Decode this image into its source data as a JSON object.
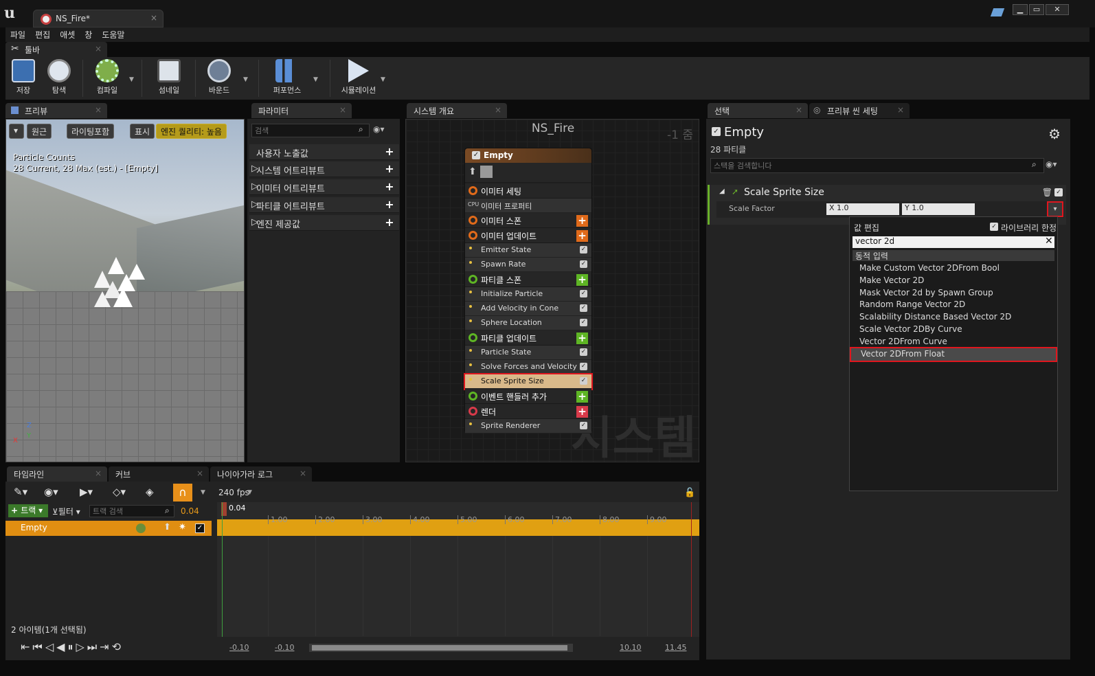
{
  "window": {
    "tab_title": "NS_Fire*",
    "close": "×",
    "min": "▁",
    "max": "▭",
    "close_btn": "✕"
  },
  "menu": [
    "파일",
    "편집",
    "애셋",
    "창",
    "도움말"
  ],
  "toolbar": {
    "tab_label": "툴바",
    "buttons": [
      {
        "label": "저장"
      },
      {
        "label": "탐색"
      },
      {
        "label": "컴파일"
      },
      {
        "label": "섬네일"
      },
      {
        "label": "바운드"
      },
      {
        "label": "퍼포먼스"
      },
      {
        "label": "시뮬레이션"
      }
    ]
  },
  "preview": {
    "tab": "프리뷰",
    "btn_perspective": "원근",
    "btn_lighting": "라이팅포함",
    "btn_show": "표시",
    "btn_quality": "엔진 퀄리티: 높음",
    "counts_title": "Particle Counts",
    "counts_text": "28 Current, 28 Max (est.) - [Empty]",
    "axis_z": "Z",
    "axis_x": "X",
    "axis_y": "Y"
  },
  "params": {
    "tab": "파라미터",
    "search_placeholder": "검색",
    "rows": [
      "사용자 노출값",
      "시스템 어트리뷰트",
      "이미터 어트리뷰트",
      "파티클 어트리뷰트",
      "엔진 제공값"
    ]
  },
  "graph": {
    "tab": "시스템 개요",
    "title": "NS_Fire",
    "zoom": "-1 줌",
    "watermark": "시스템",
    "emitter_name": "Empty",
    "sections": [
      {
        "type": "head",
        "label": "이미터 세팅",
        "color": "#e06a1a"
      },
      {
        "type": "sub",
        "label": "이미터 프로퍼티",
        "cpu": true
      },
      {
        "type": "head",
        "label": "이미터 스폰",
        "color": "#e06a1a",
        "plus": "#e06a1a"
      },
      {
        "type": "head",
        "label": "이미터 업데이트",
        "color": "#e06a1a",
        "plus": "#e06a1a"
      },
      {
        "type": "row",
        "label": "Emitter State"
      },
      {
        "type": "row",
        "label": "Spawn Rate"
      },
      {
        "type": "head",
        "label": "파티클 스폰",
        "color": "#5eb524",
        "plus": "#5eb524"
      },
      {
        "type": "row",
        "label": "Initialize Particle"
      },
      {
        "type": "row",
        "label": "Add Velocity in Cone"
      },
      {
        "type": "row",
        "label": "Sphere Location"
      },
      {
        "type": "head",
        "label": "파티클 업데이트",
        "color": "#5eb524",
        "plus": "#5eb524"
      },
      {
        "type": "row",
        "label": "Particle State"
      },
      {
        "type": "row",
        "label": "Solve Forces and Velocity"
      },
      {
        "type": "row",
        "label": "Scale Sprite Size",
        "selected": true
      },
      {
        "type": "head",
        "label": "이벤트 핸들러 추가",
        "color": "#5eb524",
        "plus": "#5eb524"
      },
      {
        "type": "head",
        "label": "렌더",
        "color": "#d83a4a",
        "plus": "#d83a4a"
      },
      {
        "type": "row",
        "label": "Sprite Renderer"
      }
    ]
  },
  "details": {
    "tab": "선택",
    "tab2": "프리뷰 씬 세팅",
    "emitter": "Empty",
    "particles": "28 파티클",
    "search_placeholder": "스택을 검색합니다",
    "module": "Scale Sprite Size",
    "prop": "Scale Factor",
    "x": "X 1.0",
    "y": "Y 1.0",
    "dropdown": {
      "title": "값 편집",
      "library_only": "라이브러리 한정",
      "search": "vector 2d",
      "category": "동적 입력",
      "items": [
        "Make Custom Vector 2DFrom Bool",
        "Make Vector 2D",
        "Mask Vector 2d by Spawn Group",
        "Random Range Vector 2D",
        "Scalability Distance Based Vector 2D",
        "Scale Vector 2DBy Curve",
        "Vector 2DFrom Curve",
        "Vector 2DFrom Float"
      ]
    }
  },
  "timeline": {
    "tab1": "타임라인",
    "tab2": "커브",
    "tab3": "나이아가라 로그",
    "fps": "240 fps",
    "track_btn": "트랙",
    "filter_btn": "필터",
    "search_placeholder": "트랙 검색",
    "time_value": "0.04",
    "track": "Empty",
    "footer": "2 아이템(1개 선택됨)",
    "current": "0.04",
    "ticks": [
      "1.00",
      "2.00",
      "3.00",
      "4.00",
      "5.00",
      "6.00",
      "7.00",
      "8.00",
      "9.00"
    ],
    "range": [
      "-0.10",
      "-0.10",
      "10.10",
      "11.45"
    ]
  }
}
